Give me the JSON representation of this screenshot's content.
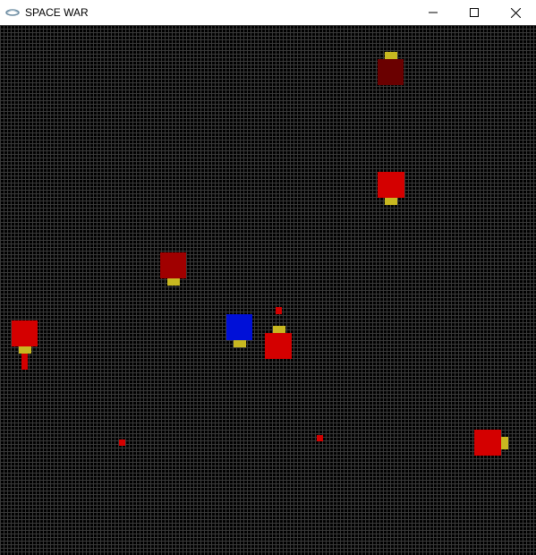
{
  "window": {
    "title": "SPACE WAR",
    "icon": "game-app-icon",
    "controls": [
      "minimize-icon",
      "maximize-icon",
      "close-icon"
    ]
  },
  "game": {
    "background_color": "#000000",
    "grid_color": "#3a3a3a",
    "colors": {
      "enemy_bright": "#d40000",
      "enemy_dark": "#6a0000",
      "enemy_medium": "#a00000",
      "player": "#0010d8",
      "gun": "#c8b820",
      "bullet": "#d40000"
    }
  }
}
